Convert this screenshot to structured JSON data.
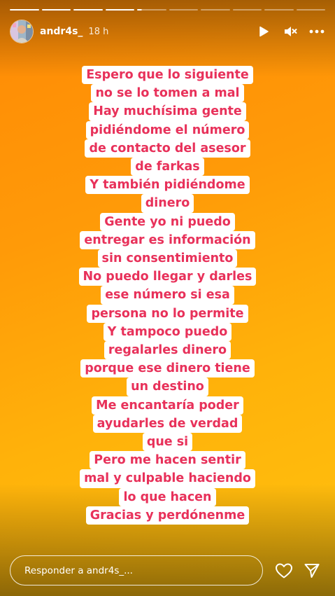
{
  "story": {
    "progress": {
      "total_segments": 10,
      "completed_segments": 4,
      "current_segment_progress": 0.16
    },
    "header": {
      "username": "andr4s_",
      "time": "18 h",
      "avatar_icon": "profile-avatar",
      "icons": [
        "play-icon",
        "mute-icon",
        "more-icon"
      ]
    },
    "text_lines": [
      "Espero que lo siguiente",
      "no se lo tomen a mal",
      "Hay muchísima gente",
      "pidiéndome el número",
      "de contacto del asesor",
      "de farkas",
      "Y también pidiéndome",
      "dinero",
      "Gente yo ni puedo",
      "entregar es información",
      "sin consentimiento",
      "No puedo llegar y darles",
      "ese número si esa",
      "persona no lo permite",
      "Y tampoco puedo",
      "regalarles dinero",
      "porque ese dinero tiene",
      "un destino",
      "Me encantaría poder",
      "ayudarles de verdad",
      "que si",
      "Pero me hacen sentir",
      "mal y culpable haciendo",
      "lo que hacen",
      "Gracias y perdónenme"
    ],
    "footer": {
      "reply_placeholder": "Responder a andr4s_...",
      "icons": [
        "heart-icon",
        "send-icon"
      ]
    },
    "colors": {
      "text_color": "#e8315a",
      "highlight": "#ffffff",
      "bg_top": "#ff8a05",
      "bg_bottom": "#ffc20f"
    }
  }
}
